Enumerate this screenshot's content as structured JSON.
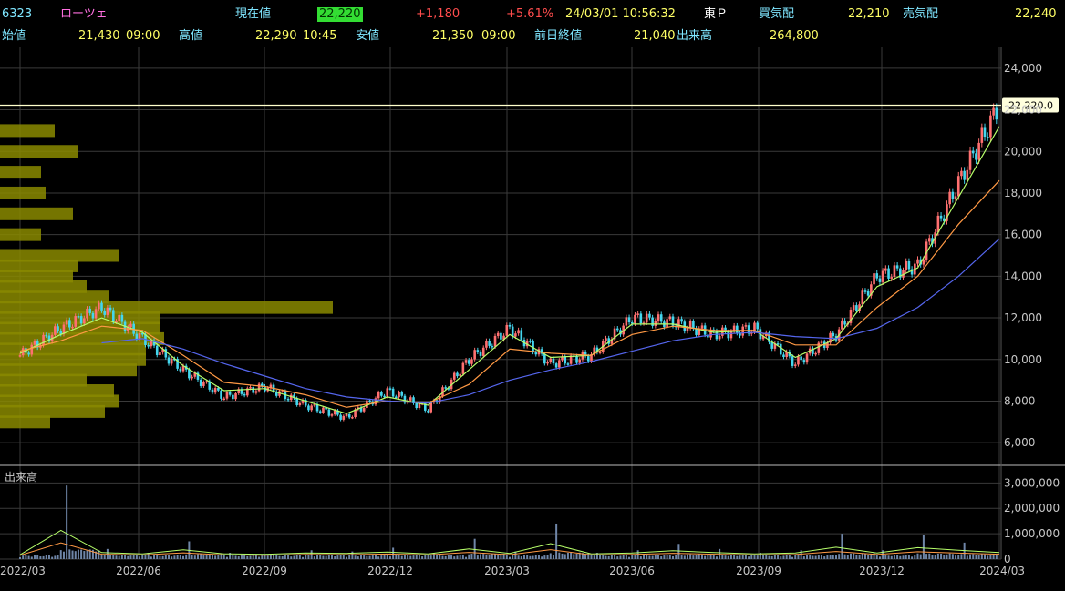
{
  "header": {
    "code": "6323",
    "name": "ローツェ",
    "current_label": "現在値",
    "current_value": "22,220",
    "change": "+1,180",
    "change_pct": "+5.61%",
    "datetime": "24/03/01  10:56:32",
    "market": "東Ｐ",
    "bid_label": "買気配",
    "bid_value": "22,210",
    "ask_label": "売気配",
    "ask_value": "22,240",
    "open_label": "始値",
    "open_value": "21,430",
    "open_time": "09:00",
    "high_label": "高値",
    "high_value": "22,290",
    "high_time": "10:45",
    "low_label": "安値",
    "low_value": "21,350",
    "low_time": "09:00",
    "prev_close_label": "前日終値",
    "prev_close_value": "21,040",
    "volume_label": "出来高",
    "volume_value": "264,800"
  },
  "volume_pane_label": "出来高",
  "price_tag": "22,220.0",
  "colors": {
    "up": "#ff7070",
    "down": "#44d6ee",
    "ma_short": "#b7ff6a",
    "ma_mid": "#ff9944",
    "ma_long": "#5566ee",
    "grid": "#3a3a3a",
    "volume_profile": "#8a8a00",
    "current_line": "#ffffcc"
  },
  "chart_data": {
    "type": "line",
    "title": "",
    "y_ticks": [
      "24,000",
      "22,000",
      "20,000",
      "18,000",
      "16,000",
      "14,000",
      "12,000",
      "10,000",
      "8,000",
      "6,000"
    ],
    "ylim": [
      5000,
      25000
    ],
    "volume_ticks": [
      "3,000,000",
      "2,000,000",
      "1,000,000",
      "0"
    ],
    "volume_ylim": [
      0,
      3300000
    ],
    "x_ticks": [
      "2022/03",
      "2022/06",
      "2022/09",
      "2022/12",
      "2023/03",
      "2023/06",
      "2023/09",
      "2023/12",
      "2024/03"
    ],
    "current_price": 22220,
    "price_series": {
      "x": [
        "2022/03",
        "2022/04",
        "2022/05",
        "2022/06",
        "2022/07",
        "2022/08",
        "2022/09",
        "2022/10",
        "2022/11",
        "2022/12",
        "2023/01",
        "2023/02",
        "2023/03",
        "2023/04",
        "2023/05",
        "2023/06",
        "2023/07",
        "2023/08",
        "2023/09",
        "2023/10",
        "2023/11",
        "2023/12",
        "2024/01",
        "2024/02",
        "2024/03"
      ],
      "close": [
        10200,
        11500,
        12500,
        11000,
        9500,
        8200,
        8700,
        7800,
        7200,
        8500,
        7600,
        10000,
        11500,
        9800,
        10200,
        12000,
        11800,
        11200,
        11500,
        9800,
        11200,
        14000,
        14500,
        18500,
        22220
      ]
    },
    "volume_series": {
      "x": [
        "2022/03",
        "2022/04",
        "2022/05",
        "2022/06",
        "2022/07",
        "2022/08",
        "2022/09",
        "2022/10",
        "2022/11",
        "2022/12",
        "2023/01",
        "2023/02",
        "2023/03",
        "2023/04",
        "2023/05",
        "2023/06",
        "2023/07",
        "2023/08",
        "2023/09",
        "2023/10",
        "2023/11",
        "2023/12",
        "2024/01",
        "2024/02",
        "2024/03"
      ],
      "values": [
        150000,
        2900000,
        400000,
        250000,
        700000,
        250000,
        200000,
        350000,
        300000,
        450000,
        250000,
        800000,
        300000,
        1400000,
        250000,
        350000,
        600000,
        400000,
        250000,
        350000,
        1000000,
        350000,
        950000,
        650000,
        400000
      ]
    },
    "ma_series": [
      {
        "name": "",
        "color": "ma_short",
        "values": [
          10300,
          11200,
          12000,
          11300,
          9700,
          8500,
          8600,
          8000,
          7400,
          8200,
          7800,
          9500,
          11200,
          10100,
          10200,
          11700,
          11700,
          11300,
          11400,
          10100,
          11000,
          13500,
          14400,
          17800,
          21200
        ]
      },
      {
        "name": "",
        "color": "ma_mid",
        "values": [
          10400,
          10900,
          11600,
          11400,
          10200,
          8900,
          8700,
          8300,
          7700,
          8000,
          7900,
          8800,
          10500,
          10300,
          10200,
          11200,
          11600,
          11400,
          11400,
          10700,
          10700,
          12500,
          14000,
          16500,
          18600
        ]
      },
      {
        "name": "",
        "color": "ma_long",
        "values": [
          null,
          null,
          10800,
          11000,
          10500,
          9800,
          9200,
          8600,
          8200,
          8000,
          7900,
          8300,
          9000,
          9500,
          9900,
          10400,
          10900,
          11200,
          11300,
          11100,
          11000,
          11500,
          12500,
          14000,
          15800
        ]
      }
    ],
    "volume_profile": {
      "price_levels": [
        7000,
        7500,
        8000,
        8500,
        9000,
        9500,
        10000,
        10500,
        11000,
        11500,
        12000,
        12500,
        13000,
        13500,
        14000,
        14500,
        15000,
        16000,
        17000,
        18000,
        19000,
        20000,
        21000
      ],
      "volumes": [
        55,
        115,
        130,
        125,
        95,
        150,
        160,
        160,
        180,
        175,
        175,
        365,
        120,
        95,
        80,
        85,
        130,
        45,
        80,
        50,
        45,
        85,
        60
      ]
    },
    "grid": true
  }
}
